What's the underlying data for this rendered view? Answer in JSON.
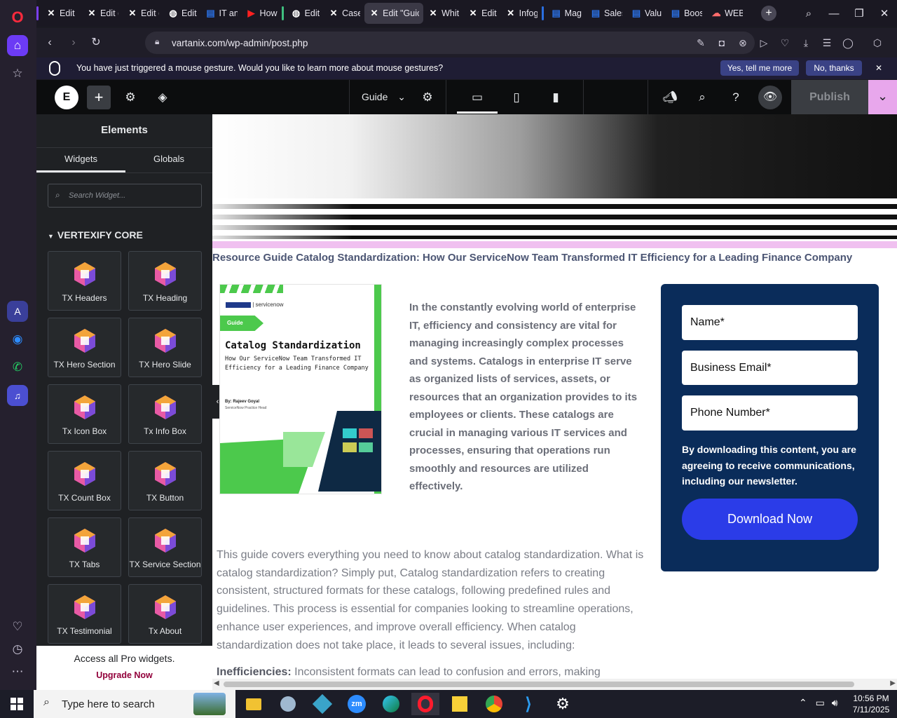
{
  "browser": {
    "tabs": [
      {
        "label": "Edit I",
        "icon": "x-logo-icon"
      },
      {
        "label": "Edit (",
        "icon": "x-logo-icon"
      },
      {
        "label": "Edit (",
        "icon": "x-logo-icon"
      },
      {
        "label": "Edit",
        "icon": "globe-icon"
      },
      {
        "label": "IT an",
        "icon": "doc-icon"
      },
      {
        "label": "How",
        "icon": "youtube-icon"
      },
      {
        "label": "Edit",
        "icon": "globe-icon"
      },
      {
        "label": "Case",
        "icon": "x-logo-icon"
      },
      {
        "label": "Edit \"Guic",
        "icon": "x-logo-icon",
        "active": true
      },
      {
        "label": "Whit",
        "icon": "x-logo-icon"
      },
      {
        "label": "Edit",
        "icon": "x-logo-icon"
      },
      {
        "label": "Infog",
        "icon": "x-logo-icon"
      },
      {
        "label": "Mag",
        "icon": "doc-icon"
      },
      {
        "label": "Sales",
        "icon": "doc-icon"
      },
      {
        "label": "Valu",
        "icon": "doc-icon"
      },
      {
        "label": "Boos",
        "icon": "doc-icon"
      },
      {
        "label": "WEB",
        "icon": "cloud-icon"
      }
    ],
    "url": "vartanix.com/wp-admin/post.php",
    "gesture": {
      "message": "You have just triggered a mouse gesture. Would you like to learn more about mouse gestures?",
      "yes_label": "Yes, tell me more",
      "no_label": "No, thanks"
    }
  },
  "elementor": {
    "template_label": "Guide",
    "publish_label": "Publish",
    "panel": {
      "title": "Elements",
      "tabs": [
        "Widgets",
        "Globals"
      ],
      "search_placeholder": "Search Widget...",
      "category": "VERTEXIFY CORE",
      "widgets": [
        "TX Headers",
        "TX Heading",
        "TX Hero Section",
        "TX Hero Slide",
        "Tx Icon Box",
        "Tx Info Box",
        "TX Count Box",
        "TX Button",
        "TX Tabs",
        "TX Service Section",
        "TX Testimonial",
        "Tx About"
      ],
      "pro_text": "Access all Pro widgets.",
      "upgrade_label": "Upgrade Now"
    }
  },
  "page": {
    "breadcrumb_title": "Resource Guide Catalog Standardization: How Our ServiceNow Team Transformed IT Efficiency for a Leading Finance Company",
    "cover": {
      "brand": "servicenow",
      "badge": "Guide",
      "title": "Catalog Standardization",
      "subtitle": "How Our ServiceNow Team Transformed IT Efficiency for a Leading Finance Company",
      "author": "By: Rajeev Goyal",
      "author_role": "ServiceNow Practice Head"
    },
    "intro": "In the constantly evolving world of enterprise IT, efficiency and consistency are vital for managing increasingly complex processes and systems. Catalogs in enterprise IT serve as organized lists of services, assets, or resources that an organization provides to its employees or clients. These catalogs are crucial in managing various IT services and processes, ensuring that operations run smoothly and resources are utilized effectively.",
    "form": {
      "name_placeholder": "Name*",
      "email_placeholder": "Business Email*",
      "phone_placeholder": "Phone Number*",
      "consent": "By downloading this content, you are agreeing to receive communications, including our newsletter.",
      "button": "Download Now"
    },
    "body_text": "This guide covers everything you need to know about catalog standardization. What is catalog standardization? Simply put, Catalog standardization refers to creating consistent, structured formats for these catalogs, following predefined rules and guidelines. This process is essential for companies looking to streamline operations, enhance user experiences, and improve overall efficiency. When catalog standardization does not take place, it leads to several issues, including:",
    "inefficiency_label": "Inefficiencies:",
    "inefficiency_text": "Inconsistent formats can lead to confusion and errors, making"
  },
  "taskbar": {
    "search_placeholder": "Type here to search",
    "time": "10:56 PM",
    "date": "7/11/2025"
  },
  "colors": {
    "accent_purple": "#f0c0f0",
    "form_bg": "#0a2c5a",
    "download_btn": "#2b3ce8",
    "cover_green": "#4cc94c"
  }
}
